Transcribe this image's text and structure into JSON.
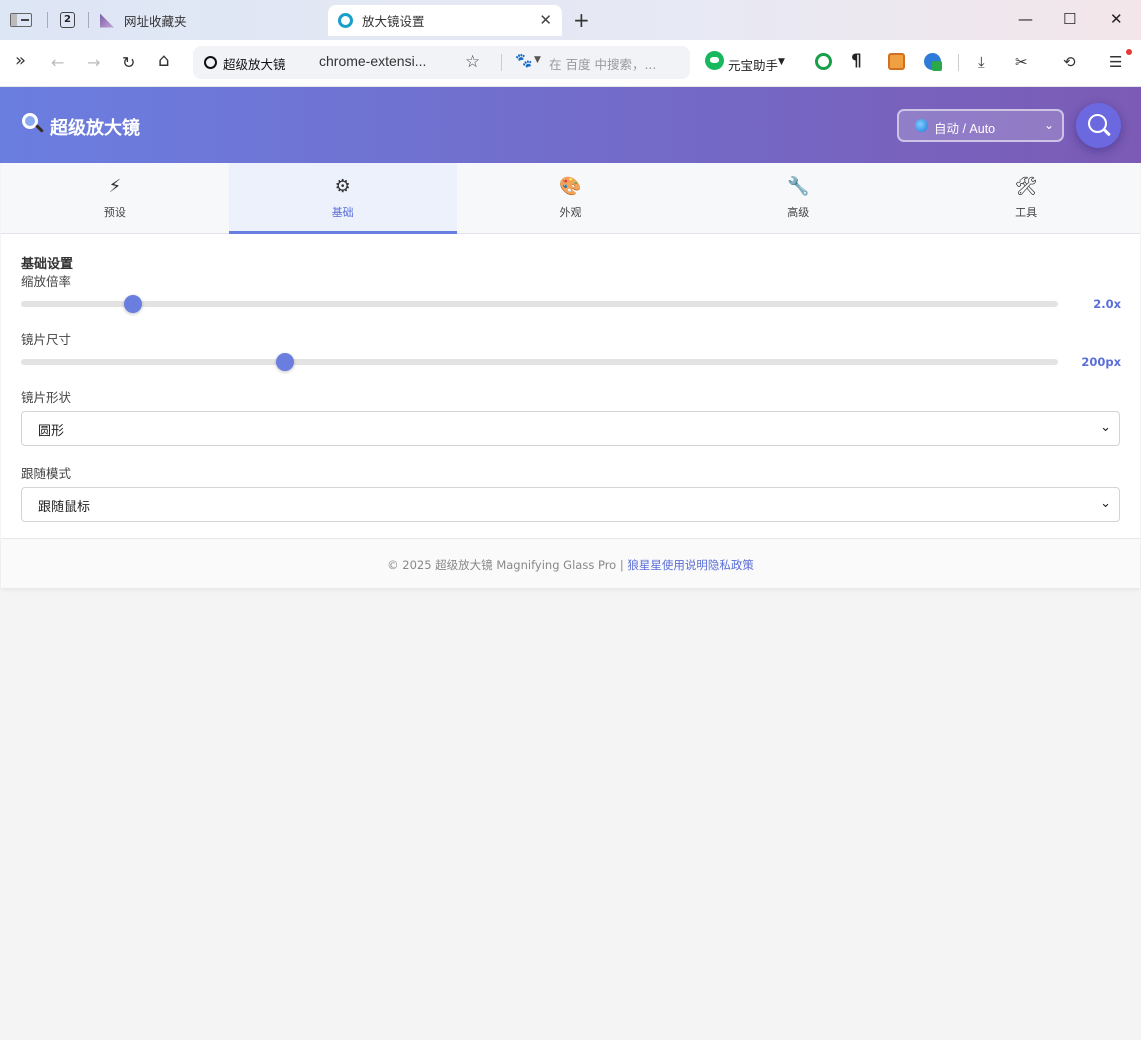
{
  "browser": {
    "tabs": [
      {
        "title": "网址收藏夹",
        "active": false
      },
      {
        "title": "放大镜设置",
        "active": true
      }
    ],
    "tab_count": "2",
    "new_tab_glyph": "+",
    "close_glyph": "✕",
    "window_controls": [
      "—",
      "☐",
      "✕"
    ],
    "nav": {
      "more": "»",
      "back": "←",
      "forward": "→",
      "reload": "↻",
      "home": "⌂"
    },
    "omnibox": {
      "site_label": "超级放大镜",
      "url": "chrome-extensi...",
      "search_placeholder": "在 百度 中搜索，...",
      "bookmark_glyph": "☆",
      "search_engine_glyph": "🐾"
    },
    "extensions": {
      "yuanbao_label": "元宝助手",
      "paragraph_glyph": "¶"
    },
    "tools": {
      "download": "⤓",
      "scissors": "✂",
      "history": "⟲",
      "menu": "☰"
    }
  },
  "app": {
    "title": "超级放大镜",
    "language_select": {
      "selected": "自动 / Auto"
    },
    "accent_color": "#6a7ee0",
    "header_gradient": [
      "#6a7ee0",
      "#7b5bb5"
    ],
    "nav_tabs": [
      {
        "label": "预设",
        "icon": "⚡",
        "icon_name": "lightning-icon"
      },
      {
        "label": "基础",
        "icon": "⚙",
        "icon_name": "gear-icon",
        "active": true
      },
      {
        "label": "外观",
        "icon": "🎨",
        "icon_name": "palette-icon"
      },
      {
        "label": "高级",
        "icon": "🔧",
        "icon_name": "wrench-icon"
      },
      {
        "label": "工具",
        "icon": "🛠",
        "icon_name": "tools-icon"
      }
    ],
    "section": {
      "title": "基础设置",
      "zoom": {
        "label": "缩放倍率",
        "value": "2.0x",
        "fraction": 0.108
      },
      "lens_size": {
        "label": "镜片尺寸",
        "value": "200px",
        "fraction": 0.255
      },
      "lens_shape": {
        "label": "镜片形状",
        "selected": "圆形"
      },
      "follow_mode": {
        "label": "跟随模式",
        "selected": "跟随鼠标"
      }
    },
    "footer": {
      "copyright": "© 2025 超级放大镜 Magnifying Glass Pro | ",
      "links": [
        "狼星星",
        "使用说明",
        "隐私政策"
      ]
    }
  }
}
